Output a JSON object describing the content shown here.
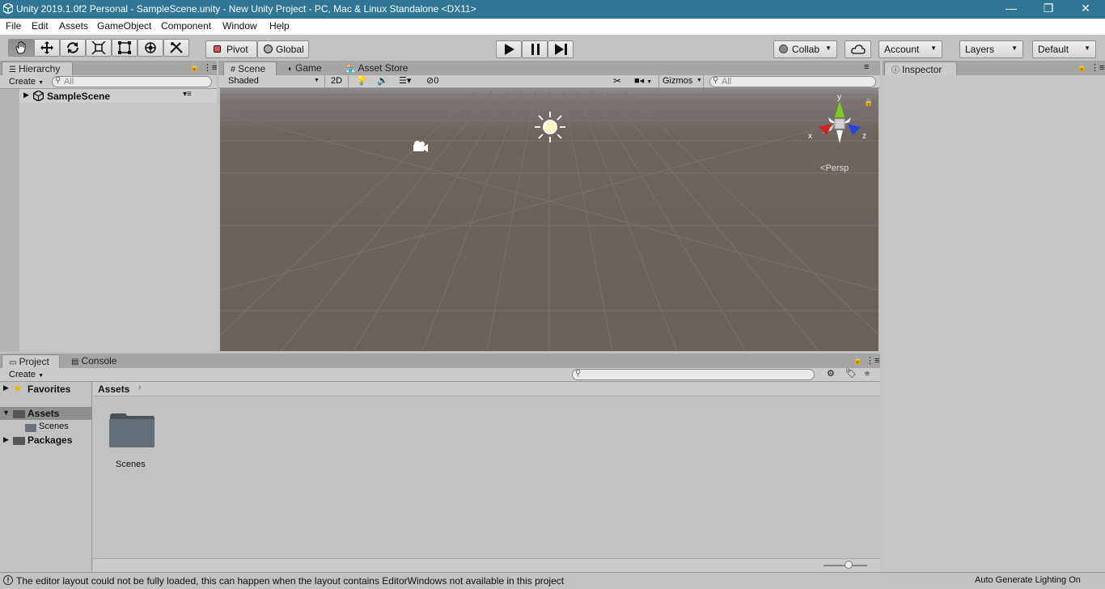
{
  "window": {
    "title": "Unity 2019.1.0f2 Personal - SampleScene.unity - New Unity Project - PC, Mac & Linux Standalone <DX11>",
    "minimize": "—",
    "restore": "❐",
    "close": "✕"
  },
  "menu": [
    "File",
    "Edit",
    "Assets",
    "GameObject",
    "Component",
    "Window",
    "Help"
  ],
  "toolbar": {
    "tools": [
      "hand-tool",
      "move-tool",
      "rotate-tool",
      "scale-tool",
      "rect-tool",
      "transform-tool",
      "custom-tool"
    ],
    "pivot_label": "Pivot",
    "global_label": "Global",
    "collab_label": "Collab",
    "account_label": "Account",
    "layers_label": "Layers",
    "layout_label": "Default"
  },
  "hierarchy": {
    "tab": "Hierarchy",
    "create": "Create",
    "search_placeholder": "All",
    "scene_name": "SampleScene"
  },
  "scene_tabs": {
    "scene": "Scene",
    "game": "Game",
    "asset_store": "Asset Store"
  },
  "scene_toolbar": {
    "shading": "Shaded",
    "mode_2d": "2D",
    "hidden_count": "0",
    "gizmos": "Gizmos",
    "search_placeholder": "All"
  },
  "scene_view": {
    "gizmo_y": "y",
    "gizmo_x": "x",
    "gizmo_z": "z",
    "projection": "Persp",
    "colors": {
      "ground": "#6f6660",
      "sky": "#8e8e90",
      "axis_x": "#d0201b",
      "axis_y": "#7fcc20",
      "axis_z": "#2744e0"
    }
  },
  "inspector": {
    "tab": "Inspector"
  },
  "project": {
    "tab": "Project",
    "console_tab": "Console",
    "create": "Create",
    "tree": {
      "favorites": "Favorites",
      "assets": "Assets",
      "scenes": "Scenes",
      "packages": "Packages"
    },
    "breadcrumb": "Assets",
    "folder_label": "Scenes"
  },
  "status": {
    "message": "The editor layout could not be fully loaded, this can happen when the layout contains EditorWindows not available in this project",
    "right": "Auto Generate Lighting On"
  }
}
